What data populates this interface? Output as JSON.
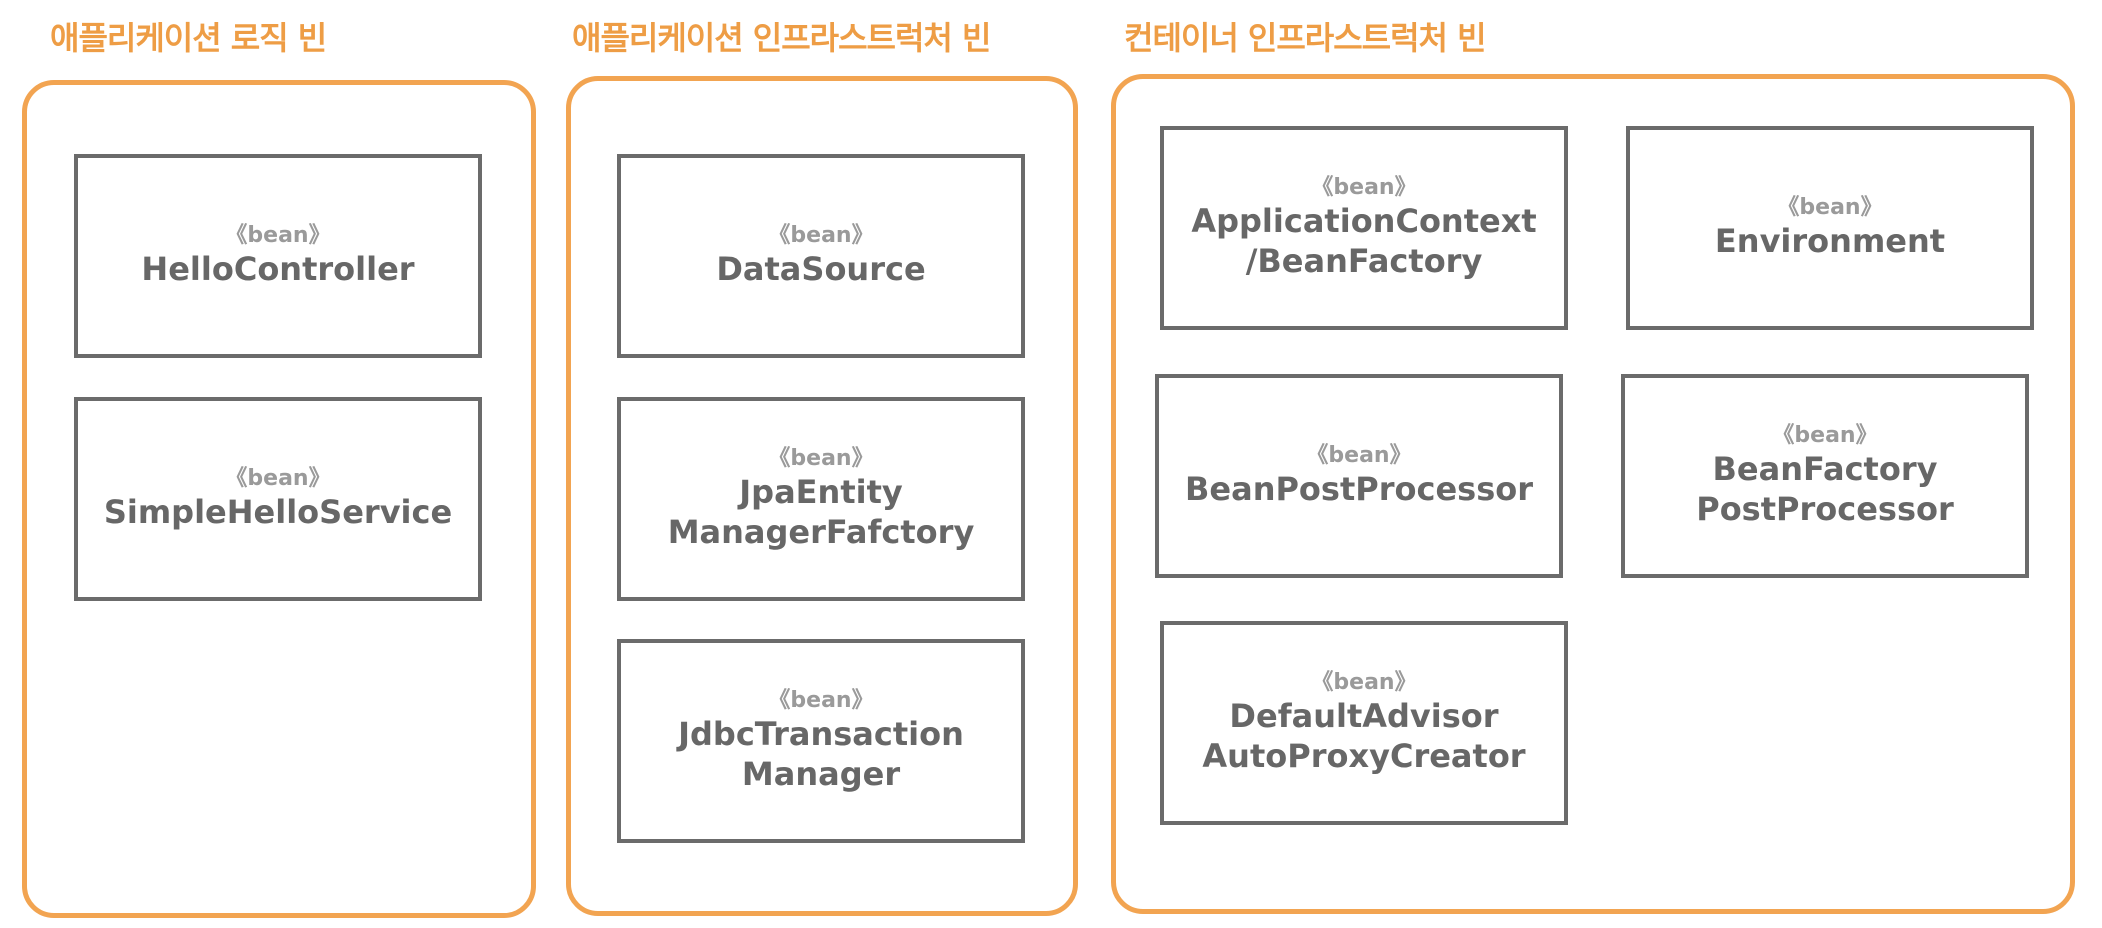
{
  "groups": [
    {
      "title": "애플리케이션 로직 빈",
      "beans": [
        {
          "stereotype": "《bean》",
          "lines": [
            "HelloController"
          ]
        },
        {
          "stereotype": "《bean》",
          "lines": [
            "SimpleHelloService"
          ]
        }
      ]
    },
    {
      "title": "애플리케이션 인프라스트럭처 빈",
      "beans": [
        {
          "stereotype": "《bean》",
          "lines": [
            "DataSource"
          ]
        },
        {
          "stereotype": "《bean》",
          "lines": [
            "JpaEntity",
            "ManagerFafctory"
          ]
        },
        {
          "stereotype": "《bean》",
          "lines": [
            "JdbcTransaction",
            "Manager"
          ]
        }
      ]
    },
    {
      "title": "컨테이너 인프라스트럭처 빈",
      "beans": [
        {
          "stereotype": "《bean》",
          "lines": [
            "ApplicationContext",
            "/BeanFactory"
          ]
        },
        {
          "stereotype": "《bean》",
          "lines": [
            "Environment"
          ]
        },
        {
          "stereotype": "《bean》",
          "lines": [
            "BeanPostProcessor"
          ]
        },
        {
          "stereotype": "《bean》",
          "lines": [
            "BeanFactory",
            "PostProcessor"
          ]
        },
        {
          "stereotype": "《bean》",
          "lines": [
            "DefaultAdvisor",
            "AutoProxyCreator"
          ]
        }
      ]
    }
  ],
  "colors": {
    "group_border": "#f2a451",
    "group_title": "#ee9d45",
    "bean_border": "#6b6b6b",
    "bean_text": "#676767",
    "stereotype_text": "#9a9a9a"
  }
}
